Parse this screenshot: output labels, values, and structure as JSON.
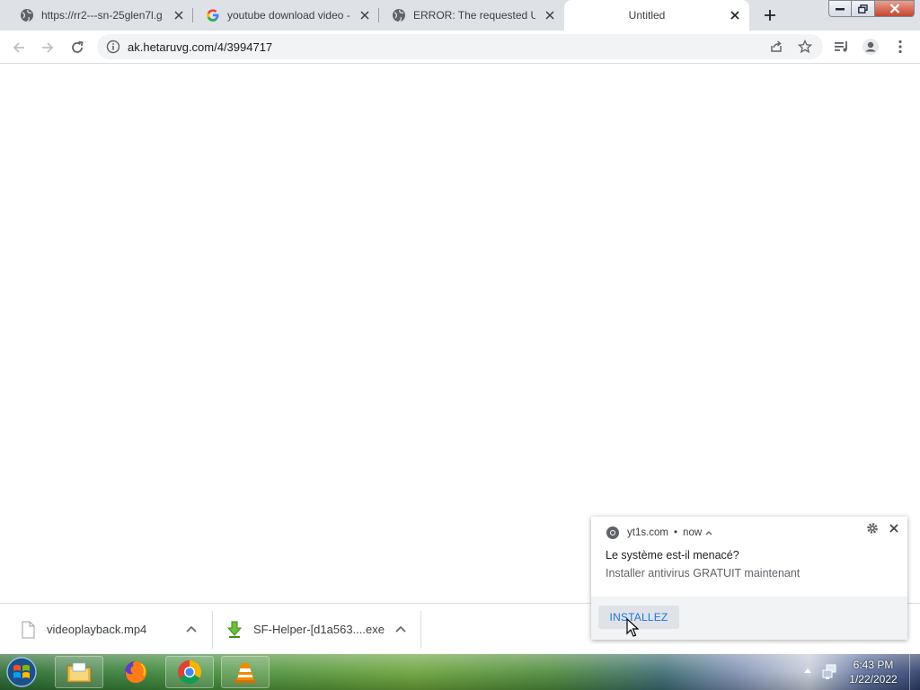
{
  "browser": {
    "tabs": [
      {
        "title": "https://rr2---sn-25glen7l.g",
        "favicon": "globe-icon"
      },
      {
        "title": "youtube download video -",
        "favicon": "google-icon"
      },
      {
        "title": "ERROR: The requested URL",
        "favicon": "globe-icon"
      },
      {
        "title": "Untitled",
        "favicon": "none",
        "active": true
      }
    ],
    "address": "ak.hetaruvg.com/4/3994717"
  },
  "downloads": [
    {
      "name": "videoplayback.mp4",
      "icon": "file-icon"
    },
    {
      "name": "SF-Helper-[d1a563....exe",
      "icon": "download-arrow-icon"
    }
  ],
  "notification": {
    "source": "yt1s.com",
    "time": "now",
    "title": "Le système est-il menacé?",
    "body": "Installer antivirus GRATUIT maintenant",
    "action": "INSTALLEZ"
  },
  "taskbar": {
    "apps": [
      "explorer-icon",
      "firefox-icon",
      "chrome-icon",
      "vlc-icon"
    ],
    "time": "6:43 PM",
    "date": "1/22/2022"
  },
  "colors": {
    "tabstrip": "#dee1e6",
    "omnibox": "#f1f3f4",
    "notif_button_text": "#1a73e8",
    "window_close": "#c7452d"
  }
}
